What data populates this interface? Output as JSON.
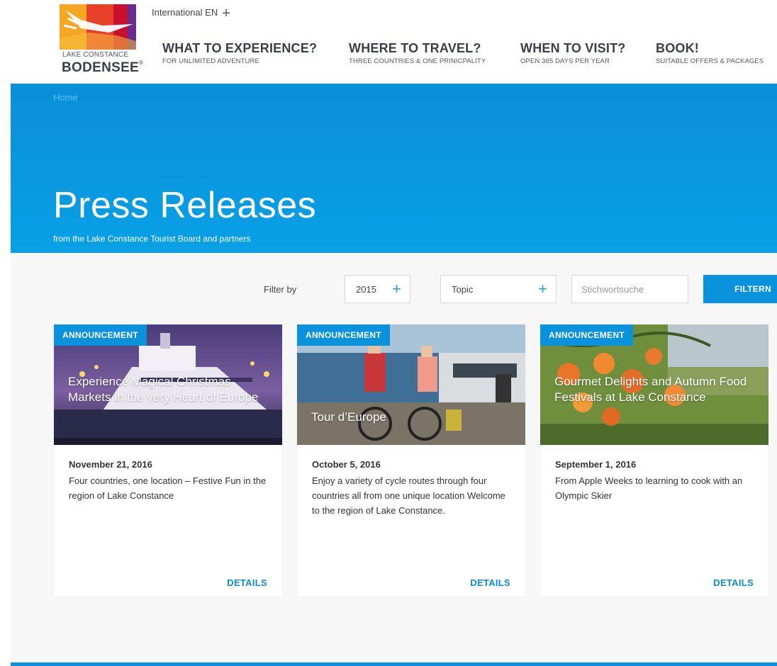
{
  "header": {
    "logo_line1": "LAKE CONSTANCE",
    "logo_line2": "BODENSEE",
    "logo_reg": "®",
    "language": "International EN",
    "language_plus": "+",
    "nav": [
      {
        "title": "WHAT TO EXPERIENCE?",
        "sub": "FOR UNLIMITED ADVENTURE"
      },
      {
        "title": "WHERE TO TRAVEL?",
        "sub": "THREE COUNTRIES & ONE PRINICPALITY"
      },
      {
        "title": "WHEN TO VISIT?",
        "sub": "OPEN 365 DAYS PER YEAR"
      },
      {
        "title": "BOOK!",
        "sub": "SUITABLE OFFERS & PACKAGES"
      }
    ]
  },
  "hero": {
    "breadcrumb": "Home",
    "title": "Press Releases",
    "subtitle": "from the Lake Constance Tourist Board and partners"
  },
  "filter": {
    "label": "Filter by",
    "year": "2015",
    "topic": "Topic",
    "plus": "+",
    "search_placeholder": "Stichwortsuche",
    "button": "FILTERN"
  },
  "cards": [
    {
      "badge": "ANNOUNCEMENT",
      "title": "Experience Magical Christmas Markets in the very Heart of Europe",
      "date": "November 21, 2016",
      "text": "Four countries, one location – Festive Fun in the region of Lake Constance",
      "details": "DETAILS"
    },
    {
      "badge": "ANNOUNCEMENT",
      "title": "Tour d’Europe",
      "date": "October 5, 2016",
      "text": "Enjoy a variety of cycle routes through four countries all from one unique location Welcome to the region of Lake Constance.",
      "details": "DETAILS"
    },
    {
      "badge": "ANNOUNCEMENT",
      "title": "Gourmet Delights and Autumn Food Festivals at Lake Constance",
      "date": "September 1, 2016",
      "text": "From Apple Weeks to learning to cook with an Olympic Skier",
      "details": "DETAILS"
    }
  ],
  "colors": {
    "brand_blue": "#0a92dc",
    "logo_orange": "#f0a020",
    "logo_red": "#d4233a",
    "logo_purple": "#5a2a8a"
  }
}
